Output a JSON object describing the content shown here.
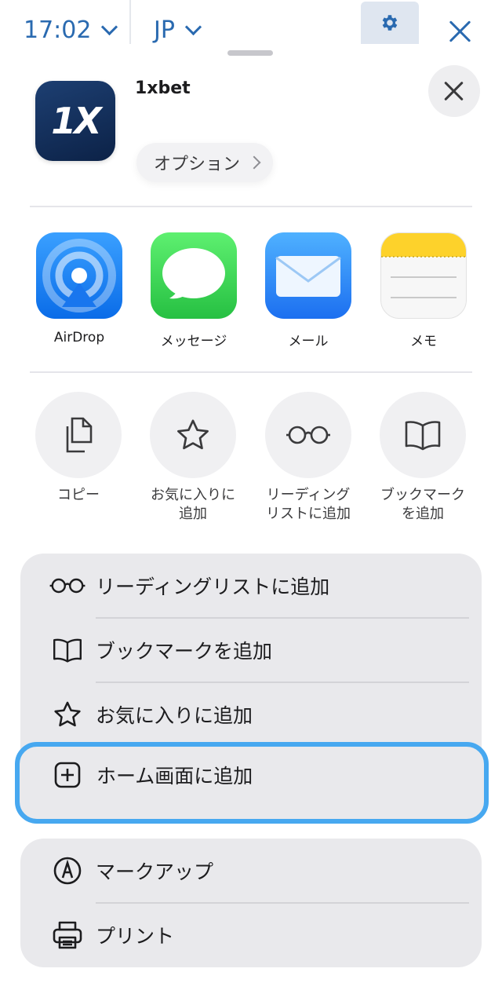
{
  "topbar": {
    "time": "17:02",
    "language": "JP"
  },
  "app": {
    "name": "1xbet",
    "icon_text": "1X",
    "options_label": "オプション"
  },
  "share_targets": [
    {
      "label": "AirDrop",
      "icon": "airdrop-icon"
    },
    {
      "label": "メッセージ",
      "icon": "messages-icon"
    },
    {
      "label": "メール",
      "icon": "mail-icon"
    },
    {
      "label": "メモ",
      "icon": "notes-icon"
    }
  ],
  "actions": [
    {
      "line1": "コピー",
      "line2": "",
      "icon": "copy-icon"
    },
    {
      "line1": "お気に入りに",
      "line2": "追加",
      "icon": "star-icon"
    },
    {
      "line1": "リーディング",
      "line2": "リストに追加",
      "icon": "glasses-icon"
    },
    {
      "line1": "ブックマーク",
      "line2": "を追加",
      "icon": "book-icon"
    }
  ],
  "list_group_1": [
    {
      "label": "リーディングリストに追加",
      "icon": "glasses-icon"
    },
    {
      "label": "ブックマークを追加",
      "icon": "book-icon"
    },
    {
      "label": "お気に入りに追加",
      "icon": "star-icon"
    },
    {
      "label": "ホーム画面に追加",
      "icon": "plus-square-icon",
      "highlighted": true
    }
  ],
  "list_group_2": [
    {
      "label": "マークアップ",
      "icon": "markup-icon"
    },
    {
      "label": "プリント",
      "icon": "printer-icon"
    }
  ],
  "colors": {
    "accent": "#2a6ab0",
    "highlight": "#47a8f0",
    "list_bg": "#e9e9ec"
  }
}
